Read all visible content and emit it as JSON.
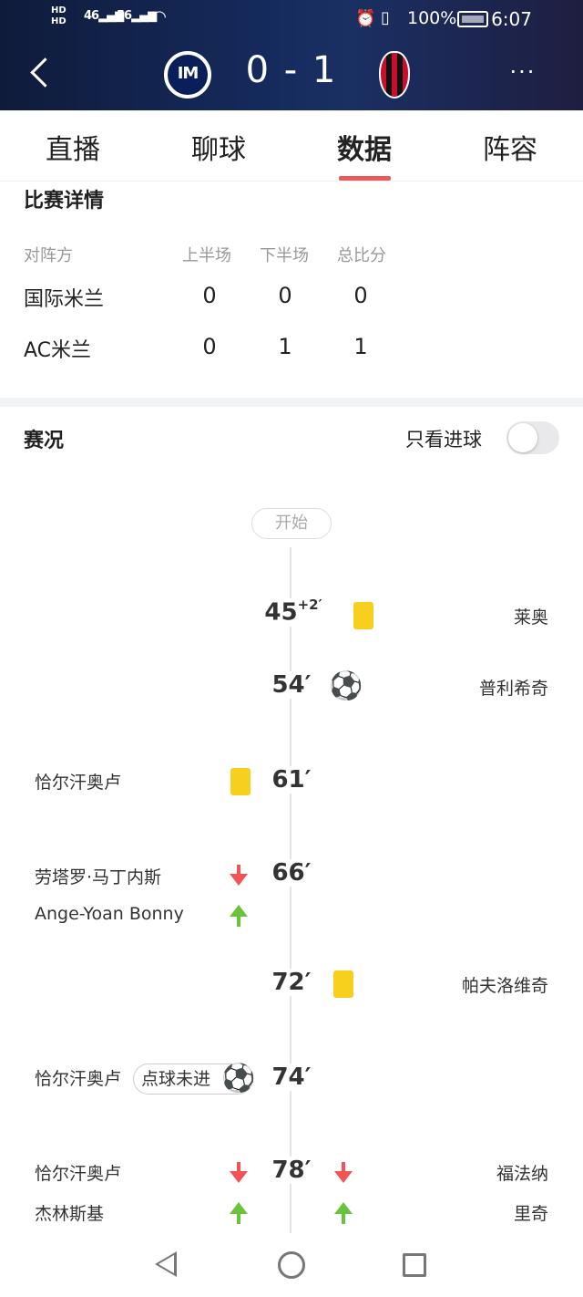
{
  "status_bar": {
    "network_left": [
      "HD",
      "HD"
    ],
    "signal_1": "46",
    "signal_2": "56",
    "battery": "100%",
    "time": "6:07"
  },
  "match_header": {
    "score": "0 - 1",
    "home_logo_text": "IM",
    "more": "···"
  },
  "tabs": [
    {
      "label": "直播",
      "active": false
    },
    {
      "label": "聊球",
      "active": false
    },
    {
      "label": "数据",
      "active": true
    },
    {
      "label": "阵容",
      "active": false
    }
  ],
  "match_detail": {
    "title": "比赛详情",
    "columns": [
      "对阵方",
      "上半场",
      "下半场",
      "总比分"
    ],
    "rows": [
      {
        "team": "国际米兰",
        "h1": "0",
        "h2": "0",
        "total": "0"
      },
      {
        "team": "AC米兰",
        "h1": "0",
        "h2": "1",
        "total": "1"
      }
    ]
  },
  "events": {
    "title": "赛况",
    "toggle_label": "只看进球",
    "toggle_on": false,
    "start_label": "开始",
    "penalty_label": "点球未进",
    "items": [
      {
        "minute": "45",
        "extra": "+2′",
        "side": "away",
        "type": "yellow-card",
        "player": "莱奥"
      },
      {
        "minute": "54′",
        "side": "away",
        "type": "goal",
        "player": "普利希奇"
      },
      {
        "minute": "61′",
        "side": "home",
        "type": "yellow-card",
        "player": "恰尔汗奥卢"
      },
      {
        "minute": "66′",
        "side": "home",
        "type": "substitution",
        "player_out": "劳塔罗·马丁内斯",
        "player_in": "Ange-Yoan Bonny"
      },
      {
        "minute": "72′",
        "side": "away",
        "type": "yellow-card",
        "player": "帕夫洛维奇"
      },
      {
        "minute": "74′",
        "side": "home",
        "type": "penalty-missed",
        "player": "恰尔汗奥卢"
      },
      {
        "minute": "78′",
        "side": "both",
        "type": "substitution",
        "home_out": "恰尔汗奥卢",
        "home_in": "杰林斯基",
        "away_out": "福法纳",
        "away_in": "里奇"
      }
    ]
  },
  "colors": {
    "header_bg": "#152a5c",
    "accent": "#e85a5a",
    "yellow_card": "#f7cf1d",
    "sub_in": "#69c43a",
    "sub_out": "#f05454"
  }
}
